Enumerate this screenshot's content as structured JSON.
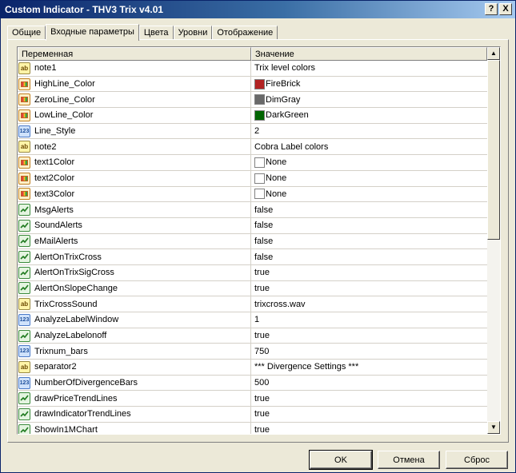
{
  "window": {
    "title": "Custom Indicator - THV3 Trix v4.01",
    "help_label": "?",
    "close_label": "X"
  },
  "tabs": [
    {
      "label": "Общие"
    },
    {
      "label": "Входные параметры"
    },
    {
      "label": "Цвета"
    },
    {
      "label": "Уровни"
    },
    {
      "label": "Отображение"
    }
  ],
  "grid": {
    "columns": {
      "name": "Переменная",
      "value": "Значение"
    },
    "rows": [
      {
        "type": "string",
        "name": "note1",
        "value": "Trix level colors"
      },
      {
        "type": "color",
        "name": "HighLine_Color",
        "value": "FireBrick",
        "swatch": "#b22222"
      },
      {
        "type": "color",
        "name": "ZeroLine_Color",
        "value": "DimGray",
        "swatch": "#696969"
      },
      {
        "type": "color",
        "name": "LowLine_Color",
        "value": "DarkGreen",
        "swatch": "#006400"
      },
      {
        "type": "int",
        "name": "Line_Style",
        "value": "2"
      },
      {
        "type": "string",
        "name": "note2",
        "value": "Cobra Label colors"
      },
      {
        "type": "color",
        "name": "text1Color",
        "value": "None",
        "swatch": "#ffffff"
      },
      {
        "type": "color",
        "name": "text2Color",
        "value": "None",
        "swatch": "#ffffff"
      },
      {
        "type": "color",
        "name": "text3Color",
        "value": "None",
        "swatch": "#ffffff"
      },
      {
        "type": "bool",
        "name": "MsgAlerts",
        "value": "false"
      },
      {
        "type": "bool",
        "name": "SoundAlerts",
        "value": "false"
      },
      {
        "type": "bool",
        "name": "eMailAlerts",
        "value": "false"
      },
      {
        "type": "bool",
        "name": "AlertOnTrixCross",
        "value": "false"
      },
      {
        "type": "bool",
        "name": "AlertOnTrixSigCross",
        "value": "true"
      },
      {
        "type": "bool",
        "name": "AlertOnSlopeChange",
        "value": "true"
      },
      {
        "type": "string",
        "name": "TrixCrossSound",
        "value": "trixcross.wav"
      },
      {
        "type": "int",
        "name": "AnalyzeLabelWindow",
        "value": "1"
      },
      {
        "type": "bool",
        "name": "AnalyzeLabelonoff",
        "value": "true"
      },
      {
        "type": "int",
        "name": "Trixnum_bars",
        "value": "750"
      },
      {
        "type": "string",
        "name": "separator2",
        "value": "*** Divergence Settings ***"
      },
      {
        "type": "int",
        "name": "NumberOfDivergenceBars",
        "value": "500"
      },
      {
        "type": "bool",
        "name": "drawPriceTrendLines",
        "value": "true"
      },
      {
        "type": "bool",
        "name": "drawIndicatorTrendLines",
        "value": "true"
      },
      {
        "type": "bool",
        "name": "ShowIn1MChart",
        "value": "true"
      }
    ]
  },
  "icons": {
    "string": "ab",
    "int": "123"
  },
  "buttons": {
    "ok": "OK",
    "cancel": "Отмена",
    "reset": "Сброс"
  }
}
